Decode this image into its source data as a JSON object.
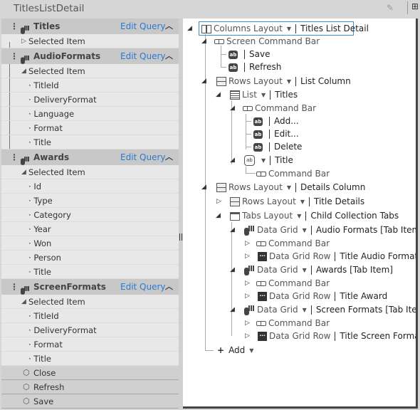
{
  "window": {
    "title": "TitlesListDetail",
    "toolbar_icons": [
      "edit-icon",
      "add-panel-icon"
    ]
  },
  "left_panel": {
    "edit_query_label": "Edit Query",
    "selected_item_label": "Selected Item",
    "sources": [
      {
        "name": "Titles",
        "expanded": false,
        "properties": []
      },
      {
        "name": "AudioFormats",
        "expanded": true,
        "properties": [
          "TitleId",
          "DeliveryFormat",
          "Language",
          "Format",
          "Title"
        ]
      },
      {
        "name": "Awards",
        "expanded": true,
        "properties": [
          "Id",
          "Type",
          "Category",
          "Year",
          "Won",
          "Person",
          "Title"
        ]
      },
      {
        "name": "ScreenFormats",
        "expanded": true,
        "properties": [
          "TitleId",
          "DeliveryFormat",
          "Format",
          "Title"
        ]
      }
    ],
    "commands": [
      "Close",
      "Refresh",
      "Save"
    ]
  },
  "tree": {
    "root": {
      "type": "Columns Layout",
      "name": "Titles List Detail"
    },
    "screen_command_bar": {
      "label": "Screen Command Bar",
      "buttons": [
        "Save",
        "Refresh"
      ]
    },
    "list_column": {
      "type": "Rows Layout",
      "name": "List Column"
    },
    "list": {
      "type": "List",
      "name": "Titles"
    },
    "list_command_bar": {
      "label": "Command Bar",
      "buttons": [
        "Add...",
        "Edit...",
        "Delete"
      ]
    },
    "list_item": {
      "name": "Title",
      "command_bar": "Command Bar"
    },
    "details_column": {
      "type": "Rows Layout",
      "name": "Details Column"
    },
    "title_details": {
      "type": "Rows Layout",
      "name": "Title Details"
    },
    "tabs": {
      "type": "Tabs Layout",
      "name": "Child Collection Tabs"
    },
    "grids": [
      {
        "type": "Data Grid",
        "name": "Audio Formats",
        "suffix": "[Tab Item]",
        "command_bar": "Command Bar",
        "row_type": "Data Grid Row",
        "row_name": "Title Audio Format"
      },
      {
        "type": "Data Grid",
        "name": "Awards",
        "suffix": "[Tab Item]",
        "command_bar": "Command Bar",
        "row_type": "Data Grid Row",
        "row_name": "Title Award"
      },
      {
        "type": "Data Grid",
        "name": "Screen Formats",
        "suffix": "[Tab Item]",
        "command_bar": "Command Bar",
        "row_type": "Data Grid Row",
        "row_name": "Title Screen Format"
      }
    ],
    "add_label": "Add"
  }
}
